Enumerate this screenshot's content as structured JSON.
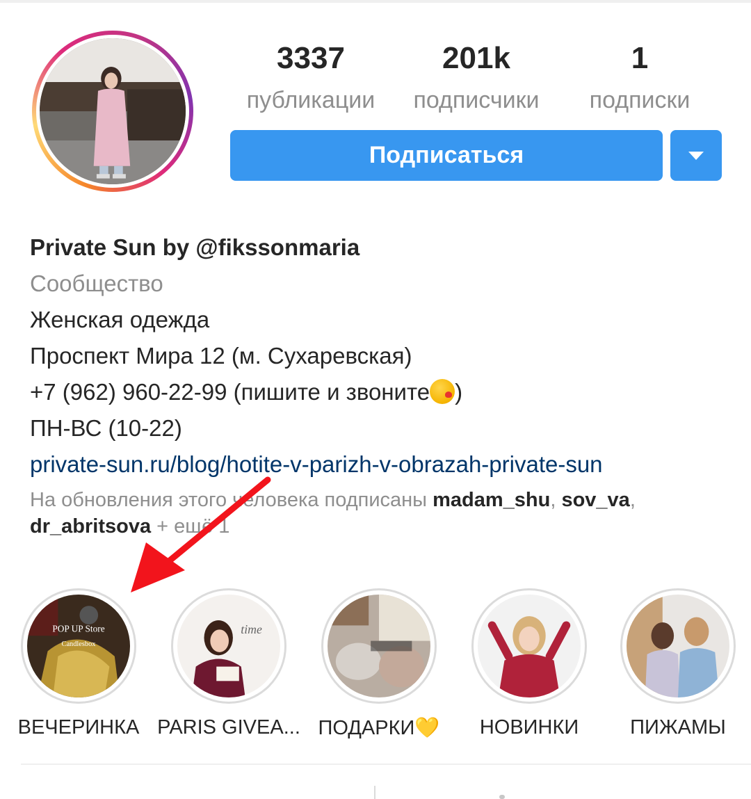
{
  "profile": {
    "stats": {
      "posts": {
        "value": "3337",
        "label": "публикации"
      },
      "followers": {
        "value": "201k",
        "label": "подписчики"
      },
      "following": {
        "value": "1",
        "label": "подписки"
      }
    },
    "follow_button": "Подписаться",
    "bio": {
      "name": "Private Sun by @fikssonmaria",
      "category": "Сообщество",
      "line1": "Женская одежда",
      "line2": "Проспект Мира 12 (м. Сухаревская)",
      "line3_before_emoji": "+7 (962) 960-22-99 (пишите и звоните",
      "line3_after_emoji": ")",
      "line4": "ПН-ВС (10-22)",
      "link": "private-sun.ru/blog/hotite-v-parizh-v-obrazah-private-sun"
    },
    "followed_by": {
      "prefix": "На обновления этого человека подписаны ",
      "users": [
        "madam_shu",
        "sov_va",
        "dr_abritsova"
      ],
      "sep1": ", ",
      "sep2": ",",
      "suffix": " + ещё 1"
    }
  },
  "highlights": [
    {
      "title": "ВЕЧЕРИНКА"
    },
    {
      "title": "PARIS GIVEA..."
    },
    {
      "title": "ПОДАРКИ💛"
    },
    {
      "title": "НОВИНКИ"
    },
    {
      "title": "ПИЖАМЫ"
    }
  ],
  "icons": {
    "dropdown": "caret-down-icon",
    "emoji": "kissing-face-emoji",
    "annotation": "red-arrow"
  },
  "colors": {
    "button": "#3897f0",
    "link": "#003569",
    "arrow": "#f2141c"
  }
}
